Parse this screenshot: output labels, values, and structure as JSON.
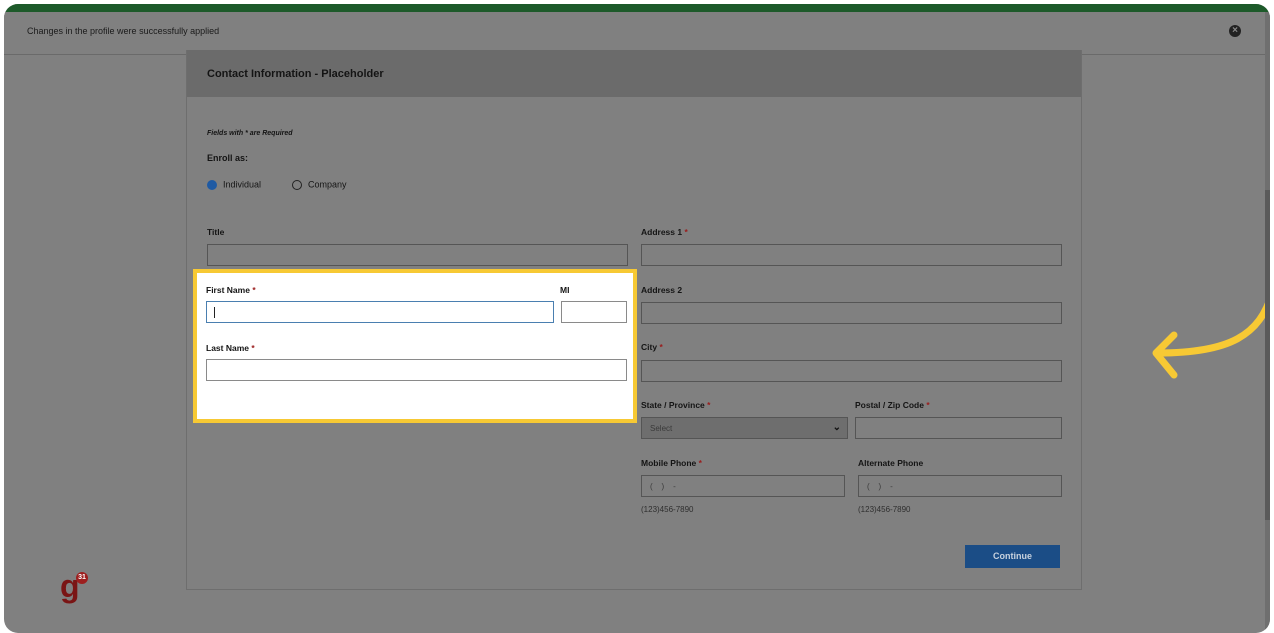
{
  "notification": {
    "message": "Changes in the profile were successfully applied",
    "close_icon": "close-circle-icon"
  },
  "form": {
    "title": "Contact Information - Placeholder",
    "required_note": "Fields with * are Required",
    "enroll_label": "Enroll as:",
    "enroll_options": [
      {
        "label": "Individual",
        "selected": true
      },
      {
        "label": "Company",
        "selected": false
      }
    ],
    "asterisk": "*",
    "title_label": "Title",
    "first_name_label": "First Name",
    "mi_label": "MI",
    "last_name_label": "Last Name",
    "address1_label": "Address 1",
    "address2_label": "Address 2",
    "city_label": "City",
    "state_label": "State / Province",
    "state_value": "Select",
    "postal_label": "Postal / Zip Code",
    "mobile_label": "Mobile Phone",
    "mobile_placeholder": "(    )    -",
    "mobile_hint": "(123)456-7890",
    "alt_label": "Alternate Phone",
    "alt_placeholder": "(    )    -",
    "alt_hint": "(123)456-7890",
    "continue_label": "Continue"
  },
  "logo": {
    "letter": "g",
    "badge": "31"
  },
  "colors": {
    "highlight": "#f7c934",
    "accent_button": "#1b4d86",
    "radio_selected": "#1f5aa3",
    "top_bar": "#1d5a2a"
  },
  "icons": [
    "close-circle-icon",
    "chevron-down-icon",
    "curved-arrow-icon"
  ]
}
